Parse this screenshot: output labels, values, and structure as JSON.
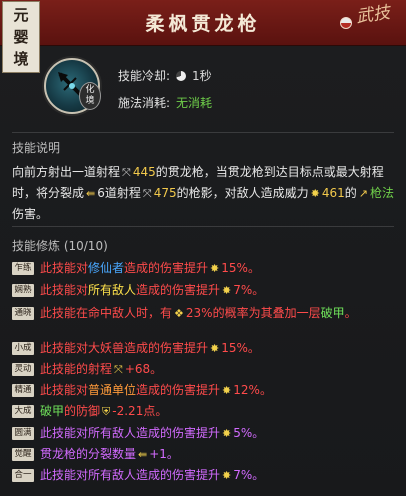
{
  "header": {
    "realm_tag": [
      "元",
      "婴",
      "境"
    ],
    "title": "柔枫贯龙枪",
    "logo_text": "武技",
    "colors": {
      "header_bg": "#6b1914",
      "accent_gold": "#f2c94c",
      "accent_green": "#6fcf4a"
    }
  },
  "skill": {
    "icon": "spear-skill-icon",
    "stage_badge": [
      "化",
      "境"
    ],
    "cooldown_label": "技能冷却:",
    "cooldown_value": "1秒",
    "cost_label": "施法消耗:",
    "cost_value": "无消耗"
  },
  "description": {
    "heading": "技能说明",
    "parts": {
      "p1": "向前方射出一道射程",
      "range1": "445",
      "p2": "的贯龙枪，当贯龙枪到达目标点或最大射程时，将分裂成",
      "split": "6道射程",
      "range2": "475",
      "p3": "的枪影，对敌人造成威力",
      "power": "461",
      "p4": "的",
      "dmg_type": "枪法",
      "p5": "伤害。"
    }
  },
  "refinements": {
    "heading": "技能修炼 (10/10)",
    "items": [
      {
        "tag": "乍练",
        "segments": [
          [
            "此技能对",
            "red"
          ],
          [
            "修仙者",
            "blue"
          ],
          [
            "造成的伤害提升",
            "red"
          ],
          [
            "15%。",
            "red"
          ]
        ]
      },
      {
        "tag": "娴熟",
        "segments": [
          [
            "此技能对",
            "red"
          ],
          [
            "所有敌人",
            "yellow"
          ],
          [
            "造成的伤害提升",
            "red"
          ],
          [
            "7%。",
            "red"
          ]
        ]
      },
      {
        "tag": "通晓",
        "segments": [
          [
            "此技能在命中敌人时，有",
            "red"
          ],
          [
            "23%的概率为其叠加一层",
            "red"
          ],
          [
            "破甲",
            "green2"
          ],
          [
            "。",
            "red"
          ]
        ]
      },
      {
        "tag": "小成",
        "segments": [
          [
            "此技能对大妖兽造成的伤害提升",
            "red"
          ],
          [
            "15%。",
            "red"
          ]
        ]
      },
      {
        "tag": "灵动",
        "segments": [
          [
            "此技能的射程",
            "red"
          ],
          [
            "+68。",
            "red"
          ]
        ]
      },
      {
        "tag": "精通",
        "segments": [
          [
            "此技能对",
            "red"
          ],
          [
            "普通单位",
            "orange"
          ],
          [
            "造成的伤害提升",
            "red"
          ],
          [
            "12%。",
            "red"
          ]
        ]
      },
      {
        "tag": "大成",
        "segments": [
          [
            "破甲",
            "green2"
          ],
          [
            "的防御",
            "red"
          ],
          [
            "-2.21点。",
            "red"
          ]
        ]
      },
      {
        "tag": "圆满",
        "segments": [
          [
            "此技能对",
            "purple"
          ],
          [
            "所有敌人",
            "purple"
          ],
          [
            "造成的伤害提升",
            "purple"
          ],
          [
            "5%。",
            "purple"
          ]
        ]
      },
      {
        "tag": "觉醒",
        "segments": [
          [
            "贯龙枪的分裂数量",
            "purple"
          ],
          [
            "+1。",
            "purple"
          ]
        ]
      },
      {
        "tag": "合一",
        "segments": [
          [
            "此技能对",
            "purple"
          ],
          [
            "所有敌人",
            "purple"
          ],
          [
            "造成的伤害提升",
            "purple"
          ],
          [
            "7%。",
            "purple"
          ]
        ]
      }
    ]
  }
}
